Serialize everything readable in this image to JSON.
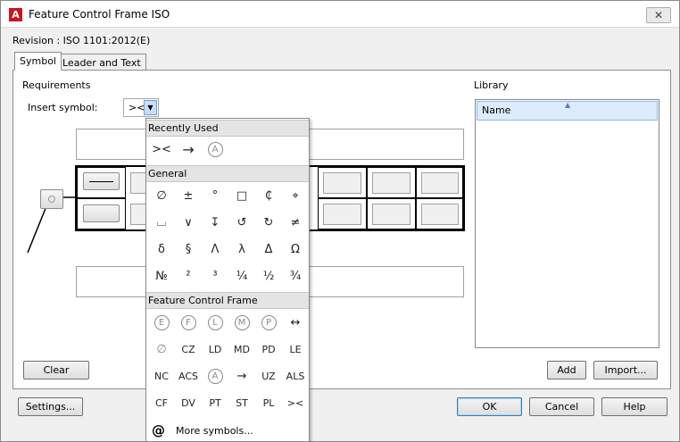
{
  "window": {
    "title": "Feature Control Frame ISO",
    "close": "✕",
    "app_icon": "A"
  },
  "revision": "Revision : ISO 1101:2012(E)",
  "tabs": [
    "Symbol",
    "Leader and Text"
  ],
  "requirements": {
    "label": "Requirements",
    "insert_symbol_label": "Insert symbol:",
    "insert_symbol_value": "><"
  },
  "library": {
    "label": "Library",
    "column": "Name"
  },
  "buttons": {
    "clear": "Clear",
    "add": "Add",
    "import": "Import...",
    "settings": "Settings...",
    "ok": "OK",
    "cancel": "Cancel",
    "help": "Help"
  },
  "popup": {
    "recent_label": "Recently Used",
    "recent": [
      "><",
      "→",
      "Ⓐ"
    ],
    "general_label": "General",
    "general": [
      [
        "∅",
        "±",
        "°",
        "□",
        "₵",
        "⌖"
      ],
      [
        "⌴",
        "∨",
        "↧",
        "↺",
        "↻",
        "≠"
      ],
      [
        "δ",
        "§",
        "Λ",
        "λ",
        "Δ",
        "Ω"
      ],
      [
        "№",
        "²",
        "³",
        "¼",
        "½",
        "¾"
      ]
    ],
    "fcf_label": "Feature Control Frame",
    "fcf": [
      [
        "E",
        "F",
        "L",
        "M",
        "P",
        "↔"
      ],
      [
        "∅",
        "CZ",
        "LD",
        "MD",
        "PD",
        "LE"
      ],
      [
        "NC",
        "ACS",
        "A",
        "→",
        "UZ",
        "ALS"
      ],
      [
        "CF",
        "DV",
        "PT",
        "ST",
        "PL",
        "><"
      ]
    ],
    "more_icon": "@",
    "more_label": "More symbols..."
  }
}
